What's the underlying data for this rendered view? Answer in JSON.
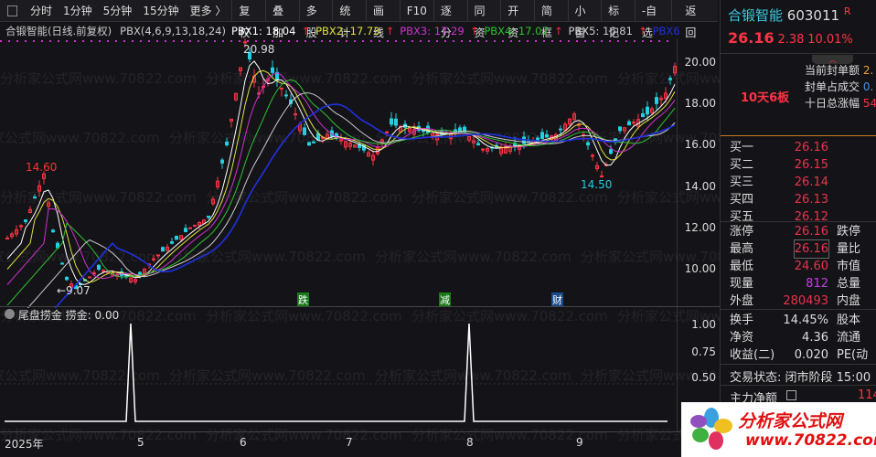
{
  "toolbar": {
    "left": [
      "分时",
      "1分钟",
      "5分钟",
      "15分钟",
      "更多 〉"
    ],
    "right": [
      "复权",
      "叠加",
      "多股",
      "统计",
      "画线",
      "F10",
      "逐分",
      "同资",
      "开资",
      "简框",
      "小窗",
      "标记",
      "-自选",
      "返回"
    ]
  },
  "legend": {
    "title": "合锻智能(日线.前复权)",
    "indicator": "PBX(4,6,9,13,18,24)",
    "pbx1": "PBX1: 18.04",
    "pbx2": "PBX2: 17.73",
    "pbx3": "PBX3: 17.29",
    "pbx4": "PBX4: 17.07",
    "pbx5": "PBX5: 16.81",
    "pbx6": "PBX6"
  },
  "colors": {
    "up": "#ff3344",
    "down": "#22d0e0",
    "pbx1": "#ffffff",
    "pbx2": "#e0e040",
    "pbx3": "#d030d0",
    "pbx4": "#30c030",
    "pbx5": "#cccccc",
    "pbx6": "#2030e0"
  },
  "chart_data": {
    "type": "candlestick",
    "y_ticks": [
      "20.00",
      "18.00",
      "16.00",
      "14.00",
      "12.00",
      "10.00"
    ],
    "ylim": [
      8.6,
      21.5
    ],
    "price_path": [
      [
        0,
        11.5
      ],
      [
        4,
        12.3
      ],
      [
        8,
        14.6
      ],
      [
        10,
        11.8
      ],
      [
        13,
        9.5
      ],
      [
        15,
        9.07
      ],
      [
        20,
        10
      ],
      [
        28,
        9.5
      ],
      [
        32,
        10.5
      ],
      [
        40,
        12
      ],
      [
        44,
        12.5
      ],
      [
        48,
        16
      ],
      [
        52,
        20.98
      ],
      [
        55,
        18.5
      ],
      [
        58,
        19.5
      ],
      [
        62,
        18
      ],
      [
        66,
        16
      ],
      [
        70,
        16.5
      ],
      [
        76,
        16
      ],
      [
        80,
        15.5
      ],
      [
        84,
        17
      ],
      [
        94,
        16.5
      ],
      [
        100,
        16.6
      ],
      [
        104,
        15.8
      ],
      [
        112,
        16
      ],
      [
        120,
        16.5
      ],
      [
        124,
        17.5
      ],
      [
        130,
        14.5
      ],
      [
        134,
        16.7
      ],
      [
        140,
        17.5
      ],
      [
        144,
        18.5
      ],
      [
        146,
        19.8
      ]
    ],
    "annotations": [
      "14.60",
      "20.98",
      "14.50",
      "←9.07"
    ],
    "signals": [
      "跌",
      "减",
      "财"
    ],
    "x_ticks": [
      "2025年",
      "5",
      "6",
      "7",
      "8",
      "9"
    ]
  },
  "sub": {
    "title": "尾盘捞金",
    "value": "捞金: 0.00",
    "y_ticks": [
      "1.00",
      "0.75",
      "0.50"
    ],
    "spikes": [
      27,
      101
    ]
  },
  "quote": {
    "name": "合锻智能",
    "code": "603011",
    "flag": "R",
    "price": "26.16",
    "change": "2.38",
    "pct": "10.01%",
    "board": "10天6板",
    "seal": [
      {
        "k": "当前封单额",
        "v": "2."
      },
      {
        "k": "封单占成交",
        "v": "0."
      },
      {
        "k": "十日总涨幅",
        "v": "54"
      }
    ],
    "bids": [
      {
        "k": "买一",
        "v": "26.16"
      },
      {
        "k": "买二",
        "v": "26.15"
      },
      {
        "k": "买三",
        "v": "26.14"
      },
      {
        "k": "买四",
        "v": "26.13"
      },
      {
        "k": "买五",
        "v": "26.12"
      }
    ],
    "stats": [
      {
        "k": "涨停",
        "v": "26.16",
        "k2": "跌停"
      },
      {
        "k": "最高",
        "v": "26.16",
        "k2": "量比"
      },
      {
        "k": "最低",
        "v": "24.60",
        "k2": "市值"
      },
      {
        "k": "现量",
        "v": "812",
        "k2": "总量"
      },
      {
        "k": "外盘",
        "v": "280493",
        "k2": "内盘"
      }
    ],
    "stats2": [
      {
        "k": "换手",
        "v": "14.45%",
        "k2": "股本"
      },
      {
        "k": "净资",
        "v": "4.36",
        "k2": "流通"
      },
      {
        "k": "收益(二)",
        "v": "0.020",
        "k2": "PE(动"
      }
    ],
    "status": "交易状态: 闭市阶段 15:00",
    "flow_label": "主力净额",
    "flow_value": "114"
  },
  "watermark": "分析家公式网www.70822.com",
  "logo": {
    "text": "分析家公式网",
    "url": "www.70822.com"
  }
}
